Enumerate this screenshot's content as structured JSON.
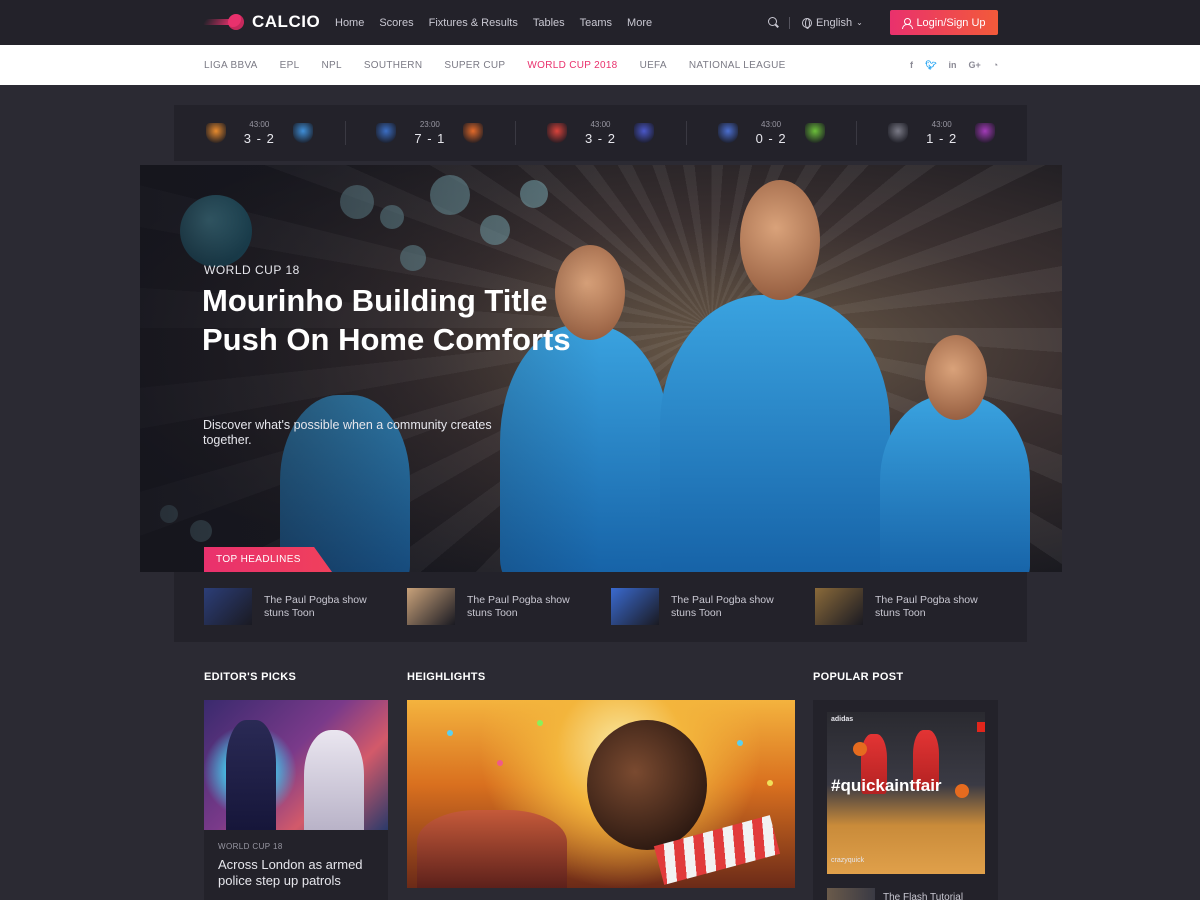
{
  "brand": {
    "name": "CALCIO"
  },
  "nav": {
    "items": [
      "Home",
      "Scores",
      "Fixtures & Results",
      "Tables",
      "Teams",
      "More"
    ]
  },
  "header": {
    "language": "English",
    "login_label": "Login/Sign Up"
  },
  "leagues": {
    "items": [
      "LIGA BBVA",
      "EPL",
      "NPL",
      "SOUTHERN",
      "SUPER CUP",
      "WORLD CUP 2018",
      "UEFA",
      "NATIONAL LEAGUE"
    ],
    "active": "WORLD CUP 2018"
  },
  "socials": [
    "f",
    "t",
    "in",
    "G+",
    "rss"
  ],
  "matches": [
    {
      "time": "43:00",
      "score": "3 - 2",
      "home_color": "#e88b2e",
      "away_color": "#3f8fd8"
    },
    {
      "time": "23:00",
      "score": "7 - 1",
      "home_color": "#3b6ec4",
      "away_color": "#e26a2a"
    },
    {
      "time": "43:00",
      "score": "3 - 2",
      "home_color": "#d9433b",
      "away_color": "#4a57c9"
    },
    {
      "time": "43:00",
      "score": "0 - 2",
      "home_color": "#4b6fd0",
      "away_color": "#6bbf3a"
    },
    {
      "time": "43:00",
      "score": "1 - 2",
      "home_color": "#7a7a86",
      "away_color": "#a33bb8"
    }
  ],
  "hero": {
    "tag": "WORLD CUP 18",
    "title": "Mourinho Building Title Push On Home Comforts",
    "description": "Discover what's possible when a community creates together.",
    "badge": "TOP HEADLINES"
  },
  "headlines": [
    {
      "text": "The Paul Pogba show stuns Toon",
      "thumb_color": "#2c3e78"
    },
    {
      "text": "The Paul Pogba show stuns Toon",
      "thumb_color": "#c9a27a"
    },
    {
      "text": "The Paul Pogba show stuns Toon",
      "thumb_color": "#3a6ad0"
    },
    {
      "text": "The Paul Pogba show stuns Toon",
      "thumb_color": "#8a6a3a"
    }
  ],
  "sections": {
    "editors_picks": "EDITOR'S PICKS",
    "highlights": "HEIGHLIGHTS",
    "popular": "POPULAR POST"
  },
  "editor_card": {
    "tag": "WORLD CUP 18",
    "title": "Across London as armed police step up patrols"
  },
  "popular_card": {
    "brand": "adidas",
    "hashtag": "#quickaintfair",
    "credit": "crazyquick",
    "next_title": "The Flash Tutorial"
  },
  "colors": {
    "accent": "#e9316d",
    "background": "#2b2a33",
    "panel": "#23222a"
  }
}
